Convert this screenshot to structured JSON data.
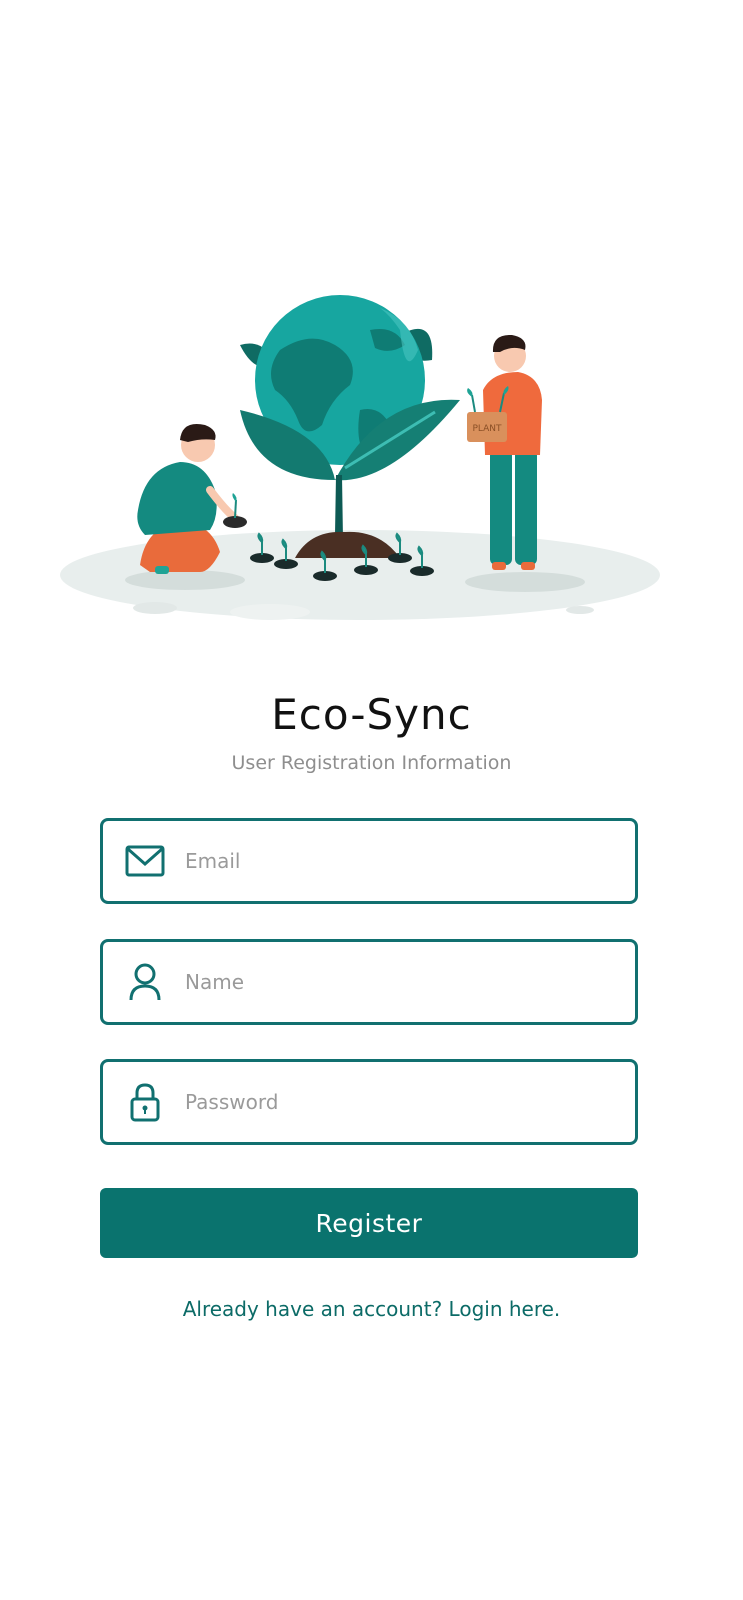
{
  "app": {
    "title": "Eco-Sync",
    "subtitle": "User Registration Information"
  },
  "illustration": {
    "sign_text": "PLANT"
  },
  "form": {
    "email": {
      "placeholder": "Email",
      "value": "",
      "icon": "envelope-icon"
    },
    "name": {
      "placeholder": "Name",
      "value": "",
      "icon": "person-icon"
    },
    "password": {
      "placeholder": "Password",
      "value": "",
      "icon": "lock-icon"
    },
    "register_label": "Register",
    "login_link_label": "Already have an account? Login here."
  },
  "colors": {
    "primary": "#0a736e",
    "border": "#117070",
    "link": "#0c6b67",
    "subtitle": "#8e8e8e"
  }
}
